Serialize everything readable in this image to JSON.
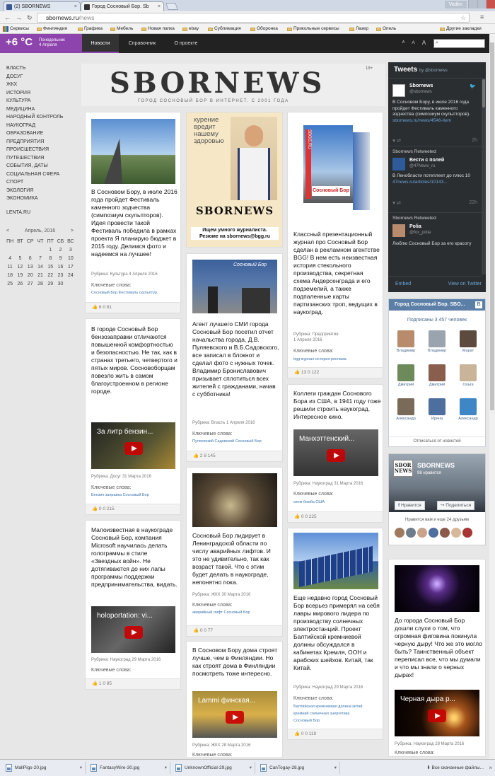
{
  "browser": {
    "tabs": [
      {
        "title": "(2) SBORNEWS",
        "favicon_color": "#3b5998"
      },
      {
        "title": "Город Сосновый Бор. Sb",
        "favicon_color": "#333333"
      }
    ],
    "user_button": "Vadim",
    "url_host": "sbornews.ru",
    "url_path": "/news",
    "bookmarks": [
      "Сервисы",
      "Финляндия",
      "Графика",
      "Мебель",
      "Новая папка",
      "ebay",
      "Сублимация",
      "Оборонка",
      "Прикольные сервисы",
      "Лазер",
      "Опель"
    ],
    "other_bookmarks": "Другие закладки"
  },
  "site": {
    "weather": {
      "temp": "+6 °C",
      "day": "Понедельник",
      "date": "4 Апреля"
    },
    "nav": [
      "Новости",
      "Справочник",
      "О проекте"
    ],
    "font_buttons": [
      "A",
      "A",
      "A"
    ],
    "logo": {
      "text": "SBORNEWS",
      "sub": "ГОРОД СОСНОВЫЙ БОР В ИНТЕРНЕТ. С 2001 ГОДА",
      "age": "18+"
    },
    "accent": "#8e44ad"
  },
  "categories": [
    "Власть",
    "Досуг",
    "ЖКХ",
    "История",
    "Культура",
    "Медицина",
    "Народный контроль",
    "Наукоград",
    "Образование",
    "Предприятия",
    "Происшествия",
    "Путешествия",
    "События, даты",
    "Социальная сфера",
    "Спорт",
    "Экология",
    "Экономика"
  ],
  "lenta": "LENTA.RU",
  "calendar": {
    "prev": "<",
    "next": ">",
    "month": "Апрель, 2016",
    "weekdays": [
      "ПН",
      "ВТ",
      "СР",
      "ЧТ",
      "ПТ",
      "СБ",
      "ВС"
    ],
    "weeks": [
      [
        "",
        "",
        "",
        "",
        "1",
        "2",
        "3"
      ],
      [
        "4",
        "5",
        "6",
        "7",
        "8",
        "9",
        "10"
      ],
      [
        "11",
        "12",
        "13",
        "14",
        "15",
        "16",
        "17"
      ],
      [
        "18",
        "19",
        "20",
        "21",
        "22",
        "23",
        "24"
      ],
      [
        "25",
        "26",
        "27",
        "28",
        "29",
        "30",
        ""
      ]
    ]
  },
  "labels": {
    "keywords": "Ключевые слова:",
    "rubric": "Рубрика:"
  },
  "cards": {
    "c1": {
      "text": "В Сосновом Бору, в июле 2016 года пройдет Фестиваль каменного зодчества (симпозиум скульпторов). Идея провести такой Фестиваль победила в рамках проекта Я планирую бюджет в 2015 году. Делимся фото и надеемся на лучшее!",
      "meta": "Рубрика: Культура   4 Апреля 2016",
      "tags": "Сосновый Бор   Фестиваль скульптур",
      "stats": "6   0   81"
    },
    "c2": {
      "text": "В городе Сосновый Бор бензозаправки отличаются повышенной комфортностью и безопасностью. Не так, как в странах третьего, четвертого и пятых миров. Сосновоборцам повезло жить в самом благоустроенном в регионе городе.",
      "video": "За литр бензин...",
      "meta": "Рубрика: Досуг   31 Марта 2016",
      "tags": "Бензин   заправка   Сосновый Бор",
      "stats": "0   0   215"
    },
    "c3": {
      "text": "Малоизвестная в наукограде Сосновый Бор, компания Microsoft научилась делать голограммы в стиле «Звездных войн». Не дотягиваются до них лапы программы поддержки предпринимательства, видать.",
      "video": "holoportation: vi...",
      "meta": "Рубрика: Наукоград   29 Марта 2016",
      "stats": "1   0   95"
    },
    "ad": {
      "headline": "курение вредит нашему здоровью",
      "logo": "SBORNEWS",
      "line1": "Ищем умного журналиста.",
      "line2": "Резюме на sbornews@bgg.ru"
    },
    "c4": {
      "imgtext": "Сосновый Бор",
      "text": "Агент лучшего СМИ города Сосновый Бор посетил отчет начальства города, Д.В. Пуляевского и В.Б.Садовского, все записал в блокнот и сделал фото с нужных точек. Владимир Брониславович призывает сплотиться всех жителей с гражданами, начав с субботника!",
      "meta": "Рубрика: Власть   1 Апреля 2016",
      "tags": "Пуляевский   Садовский   Сосновый Бор",
      "stats": "2   8   145"
    },
    "c5": {
      "text": "Сосновый Бор лидирует в Ленинградской области по числу аварийных лифтов. И это не удивительно, так как возраст такой. Что с этим будет делать в наукограде, непонятно пока.",
      "meta": "Рубрика: ЖКХ   30 Марта 2016",
      "tags": "аварийный   лифт   Сосновый Бор",
      "stats": "0   0   77"
    },
    "c6": {
      "text": "В Сосновом Бору дома строят лучше, чем в Финляндии. Но как строят дома в Финляндии посмотреть тоже интересно.",
      "video": "Lammi финская...",
      "meta": "Рубрика: ЖКХ   28 Марта 2016"
    },
    "c7": {
      "booktitle": "Сосновый Бор",
      "bookside": "SBGG.RU",
      "text": "Классный презентационный журнал про Сосновый Бор сделан в рекламном агентстве BGG! В нем есть неизвестная история стекольного производства, секретная схема Андерсенграда и его подземелий, а также подпаленные карты партизанских троп, ведущих в наукоград.",
      "meta1": "Рубрика: Предприятия",
      "meta2": "1 Апреля 2016",
      "tags": "bgg   журнал   история   реклама",
      "stats": "13   0   122"
    },
    "c8": {
      "text": "Коллеги граждан Соснового Бора из США, в 1941 году тоже решили строить наукоград. Интересное кино.",
      "video": "Манхэттенский...",
      "meta": "Рубрика: Наукоград   31 Марта 2016",
      "tags": "атом   бомба   США",
      "stats": "0   0   225"
    },
    "c9": {
      "text": "Еще недавно город Сосновый Бор всерьез примерял на себя лавры мирового лидера по производству солнечных электростанций. Проект Балтийской кремниевой долины обсуждался в кабинетах Кремля, ООН и арабских шейхов. Китай, так Китай.",
      "meta": "Рубрика: Наукоград   29 Марта 2016",
      "tags1": "Балтийская кремниевая долина   китай",
      "tags2": "кремний   солнечная энергетика",
      "tags3": "Сосновый Бор",
      "stats": "0   0   119"
    },
    "c10": {
      "text": "До города Сосновый Бор дошли слухи о том, что огромная фиговина покинула черную дыру! Что же это могло быть? Таинственный объект переписал все, что мы думали и что мы знали о черных дырах!",
      "video": "Черная дыра р...",
      "meta": "Рубрика: Наукоград   28 Марта 2016"
    }
  },
  "twitter": {
    "title": "Tweets",
    "by": "by @sbornews",
    "t1": {
      "name": "Sbornews",
      "handle": "@sbornews",
      "text": "В Сосновом Бору, в июле 2016 года пройдет Фестиваль каменного зодчества (симпозиум скульпторов).",
      "link": "sbornews.ru/news/4546-item",
      "time": "2h"
    },
    "t2": {
      "retweet": "Sbornews Retweeted",
      "name": "Вести с полей",
      "handle": "@47News_ru",
      "text": "В Ленобласти потеплеет до плюс 10",
      "link": "47news.ru/articles/10143...",
      "time": "22h"
    },
    "t3": {
      "retweet": "Sbornews Retweeted",
      "name": "Polia",
      "handle": "@fox_polia",
      "text": "Люблю Сосновый Бор за его красоту"
    },
    "embed": "Embed",
    "view": "View on Twitter"
  },
  "vk": {
    "title": "Город Сосновый Бор. SBO...",
    "count": "Подписаны 3 457 человек",
    "members": [
      "Владимир",
      "Владимир",
      "Марат",
      "Дмитрий",
      "Дмитрий",
      "Ольга",
      "Александр",
      "Ирина",
      "Александр"
    ],
    "unsubscribe": "Отписаться от новостей"
  },
  "facebook": {
    "logo": "SBOR NEWS",
    "name": "SBORNEWS",
    "likes": "98 нравится",
    "like_btn": "Нравится",
    "share_btn": "Поделиться",
    "friends": "Нравится вам и еще 24 друзьям"
  },
  "downloads": {
    "files": [
      "MallPigs-20.jpg",
      "FantasyWire-30.jpg",
      "UnknownOfficial-29.jpg",
      "CanTogay-28.jpg"
    ],
    "all": "Все скачанные файлы...",
    "close": "×"
  }
}
